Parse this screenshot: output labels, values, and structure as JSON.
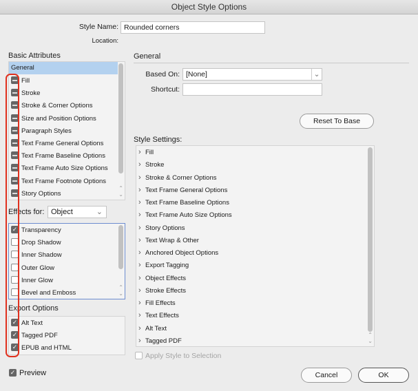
{
  "window": {
    "title": "Object Style Options"
  },
  "style_name": {
    "label": "Style Name:",
    "value": "Rounded corners"
  },
  "location": {
    "label": "Location:"
  },
  "basic_attributes": {
    "heading": "Basic Attributes",
    "selected": "General",
    "items": [
      "Fill",
      "Stroke",
      "Stroke & Corner Options",
      "Size and Position Options",
      "Paragraph Styles",
      "Text Frame General Options",
      "Text Frame Baseline Options",
      "Text Frame Auto Size Options",
      "Text Frame Footnote Options",
      "Story Options"
    ]
  },
  "effects": {
    "label": "Effects for:",
    "value": "Object",
    "items": [
      {
        "label": "Transparency",
        "checked": true
      },
      {
        "label": "Drop Shadow",
        "checked": false
      },
      {
        "label": "Inner Shadow",
        "checked": false
      },
      {
        "label": "Outer Glow",
        "checked": false
      },
      {
        "label": "Inner Glow",
        "checked": false
      },
      {
        "label": "Bevel and Emboss",
        "checked": false
      }
    ]
  },
  "export": {
    "heading": "Export Options",
    "items": [
      {
        "label": "Alt Text",
        "checked": true
      },
      {
        "label": "Tagged PDF",
        "checked": true
      },
      {
        "label": "EPUB and HTML",
        "checked": true
      }
    ]
  },
  "preview": {
    "label": "Preview",
    "checked": true
  },
  "general": {
    "heading": "General",
    "based_on_label": "Based On:",
    "based_on_value": "[None]",
    "shortcut_label": "Shortcut:",
    "shortcut_value": "",
    "reset_label": "Reset To Base"
  },
  "style_settings": {
    "heading": "Style Settings:",
    "items": [
      "Fill",
      "Stroke",
      "Stroke & Corner Options",
      "Text Frame General Options",
      "Text Frame Baseline Options",
      "Text Frame Auto Size Options",
      "Story Options",
      "Text Wrap & Other",
      "Anchored Object Options",
      "Export Tagging",
      "Object Effects",
      "Stroke Effects",
      "Fill Effects",
      "Text Effects",
      "Alt Text",
      "Tagged PDF"
    ]
  },
  "apply": {
    "label": "Apply Style to Selection",
    "checked": false,
    "disabled": true
  },
  "buttons": {
    "cancel": "Cancel",
    "ok": "OK"
  },
  "colors": {
    "selection": "#b3d1ef",
    "highlight_annotation": "#e0301e",
    "focus": "#6c8ccf"
  }
}
